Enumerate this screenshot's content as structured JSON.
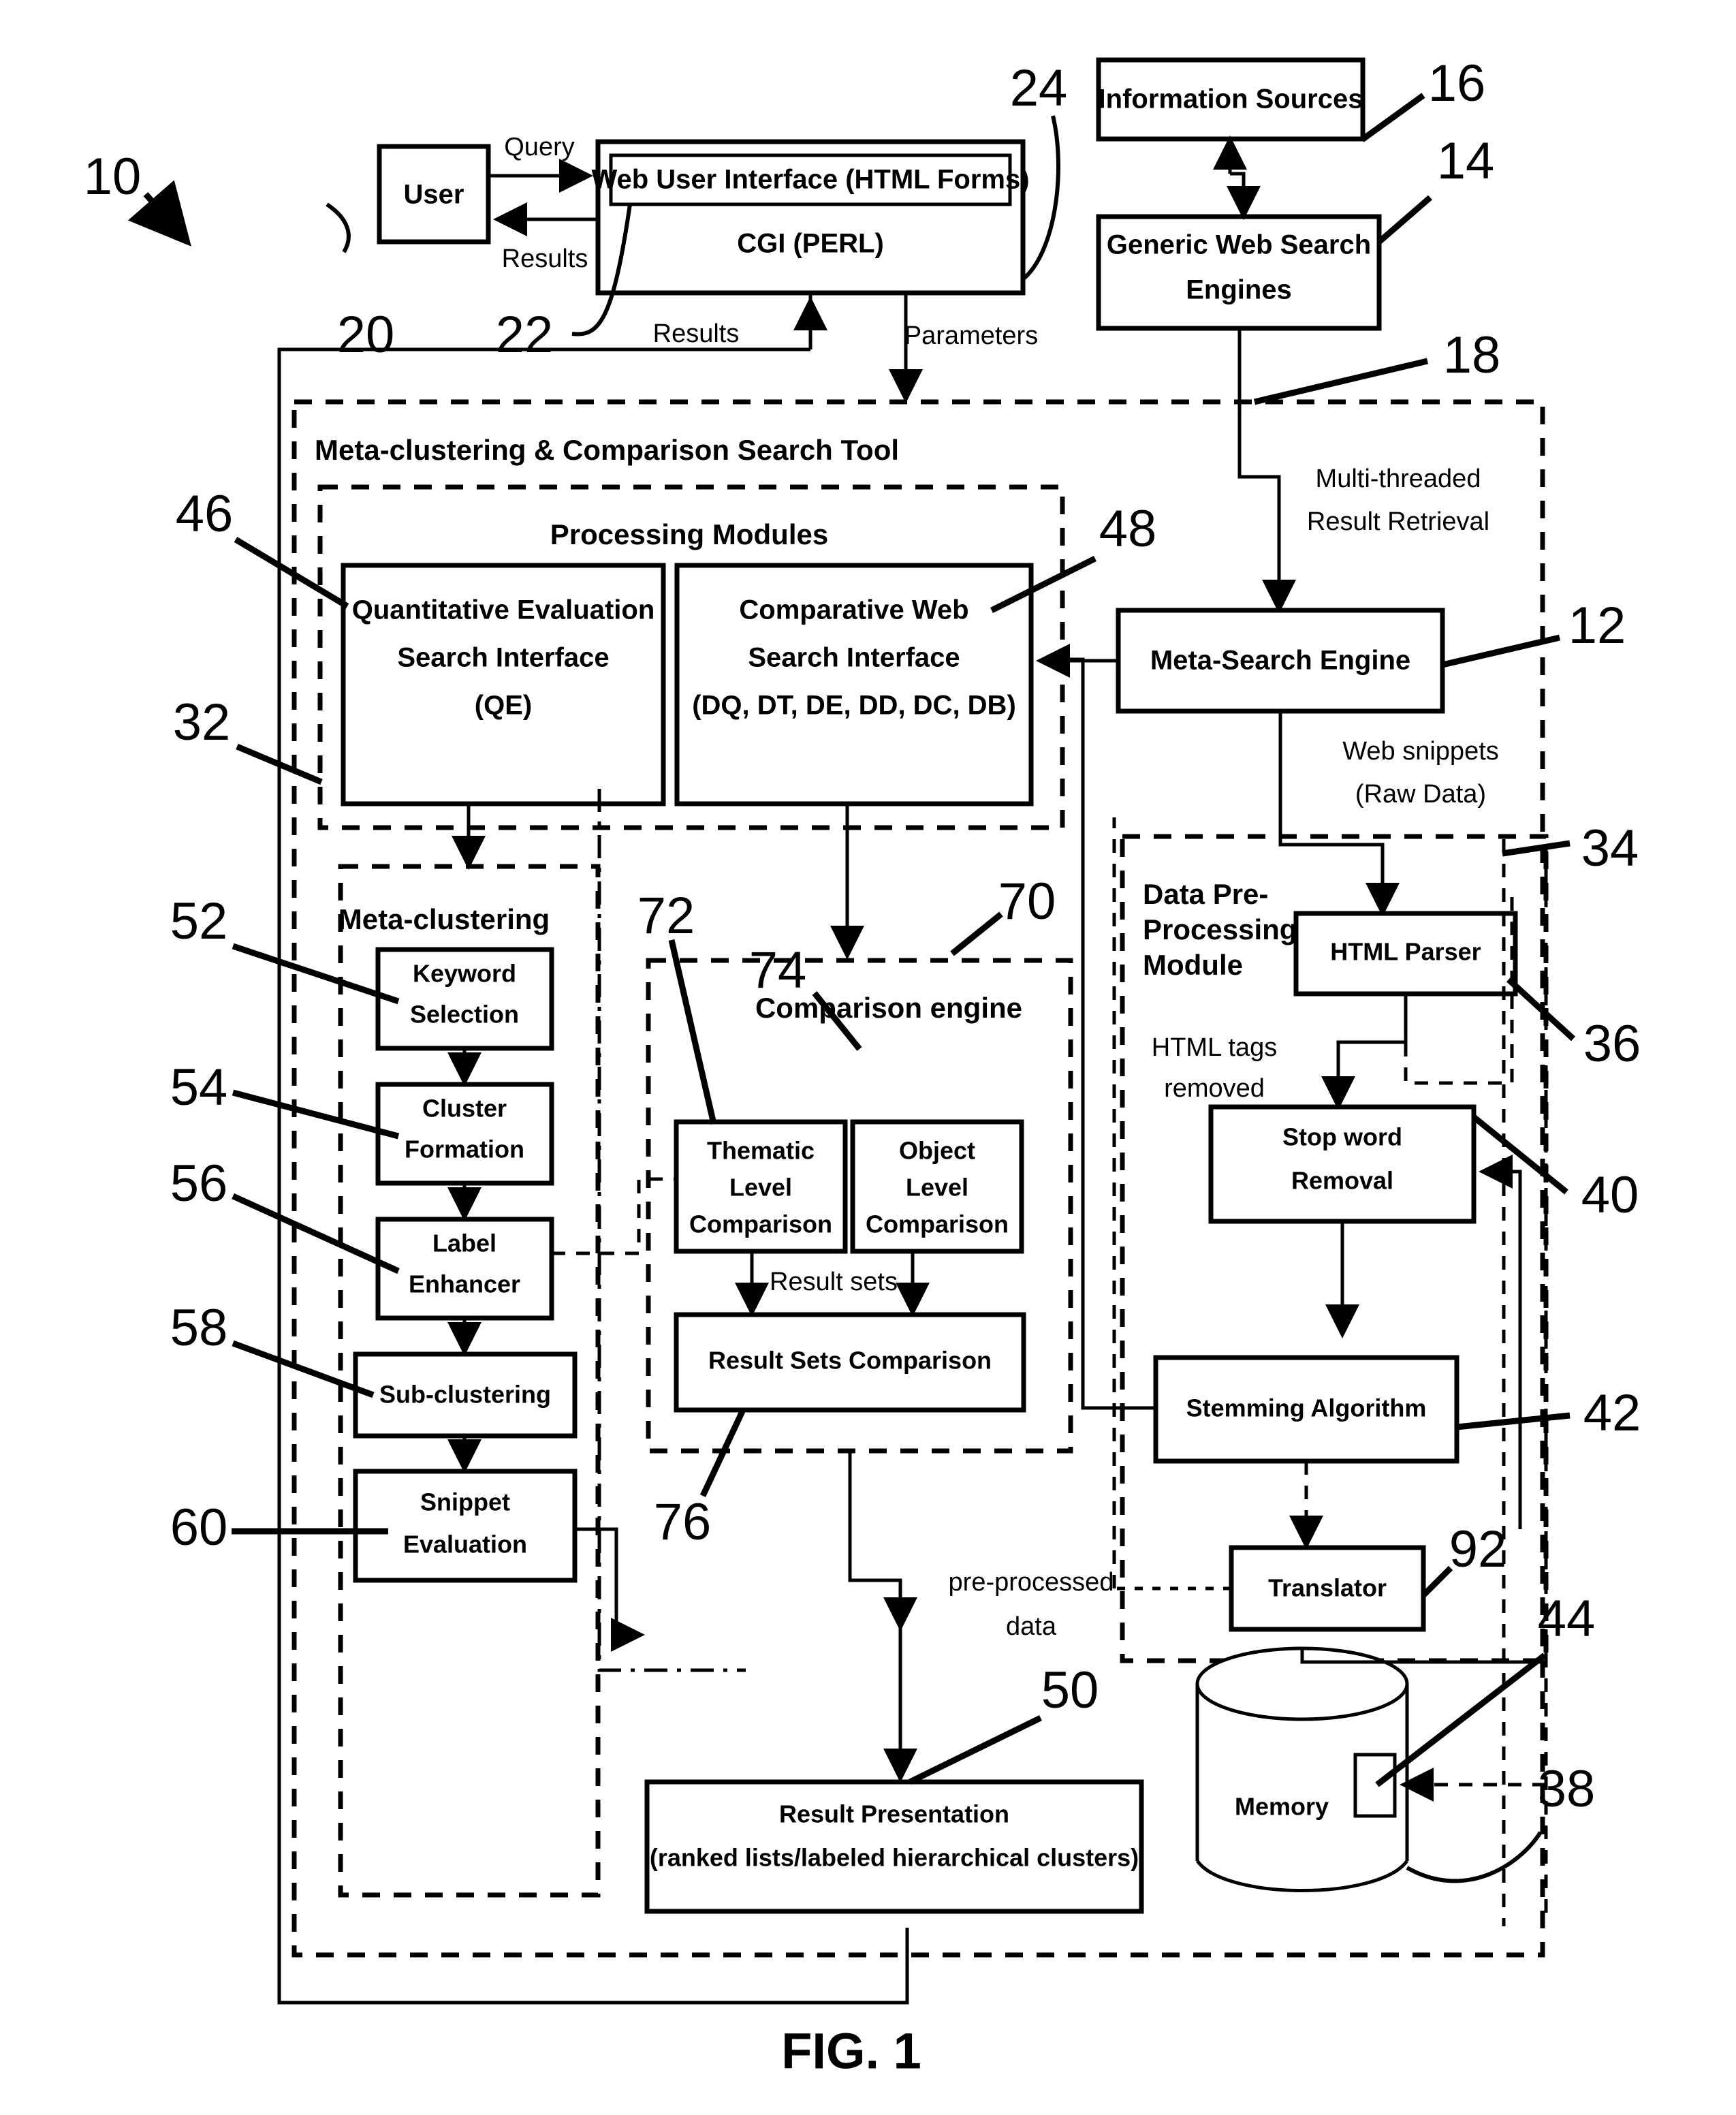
{
  "figure": {
    "caption": "FIG. 1",
    "system_ref": "10"
  },
  "boxes": {
    "user": {
      "label": "User",
      "ref": "20"
    },
    "web_ui": {
      "line1": "Web User Interface (HTML Forms)",
      "line2": "CGI (PERL)",
      "ref_inner": "22",
      "ref_outer": "24"
    },
    "information_sources": {
      "label": "Information Sources",
      "ref": "16"
    },
    "generic_web_search_engines": {
      "line1": "Generic Web Search",
      "line2": "Engines",
      "ref": "14"
    },
    "meta_search_engine": {
      "label": "Meta-Search Engine",
      "ref": "12"
    },
    "quantitative_evaluation": {
      "line1": "Quantitative Evaluation",
      "line2": "Search Interface",
      "line3": "(QE)",
      "ref": "46"
    },
    "comparative_web": {
      "line1": "Comparative Web",
      "line2": "Search Interface",
      "line3": "(DQ, DT, DE, DD, DC, DB)",
      "ref": "48"
    },
    "keyword_selection": {
      "line1": "Keyword",
      "line2": "Selection",
      "ref": "52"
    },
    "cluster_formation": {
      "line1": "Cluster",
      "line2": "Formation",
      "ref": "54"
    },
    "label_enhancer": {
      "line1": "Label",
      "line2": "Enhancer",
      "ref": "56"
    },
    "sub_clustering": {
      "label": "Sub-clustering",
      "ref": "58"
    },
    "snippet_evaluation": {
      "line1": "Snippet",
      "line2": "Evaluation",
      "ref": "60"
    },
    "thematic_level_comparison": {
      "line1": "Thematic",
      "line2": "Level",
      "line3": "Comparison",
      "ref": "72"
    },
    "object_level_comparison": {
      "line1": "Object",
      "line2": "Level",
      "line3": "Comparison",
      "ref": "74"
    },
    "result_sets_comparison": {
      "label": "Result Sets Comparison",
      "ref": "76"
    },
    "result_presentation": {
      "line1": "Result Presentation",
      "line2": "(ranked lists/labeled hierarchical clusters)",
      "ref": "50"
    },
    "html_parser": {
      "label": "HTML Parser",
      "ref": "36"
    },
    "stop_word_removal": {
      "line1": "Stop word",
      "line2": "Removal",
      "ref": "40"
    },
    "stemming_algorithm": {
      "label": "Stemming Algorithm",
      "ref": "42"
    },
    "translator": {
      "label": "Translator",
      "ref": "92"
    },
    "memory": {
      "label": "Memory",
      "ref_inner": "44",
      "ref_outer": "38"
    }
  },
  "groups": {
    "meta_clustering_tool": {
      "title": "Meta-clustering & Comparison Search Tool",
      "ref": "18"
    },
    "processing_modules": {
      "title": "Processing Modules",
      "ref": "32"
    },
    "meta_clustering": {
      "title": "Meta-clustering"
    },
    "comparison_engine": {
      "title": "Comparison engine",
      "ref": "70"
    },
    "data_preprocessing": {
      "line1": "Data Pre-",
      "line2": "Processing",
      "line3": "Module",
      "ref": "34"
    }
  },
  "edges": {
    "query": "Query",
    "results_user": "Results",
    "results_up": "Results",
    "parameters": "Parameters",
    "multi_threaded": {
      "line1": "Multi-threaded",
      "line2": "Result Retrieval"
    },
    "web_snippets": {
      "line1": "Web snippets",
      "line2": "(Raw Data)"
    },
    "html_tags_removed": {
      "line1": "HTML tags",
      "line2": "removed"
    },
    "result_sets": "Result sets",
    "pre_processed_data": {
      "line1": "pre-processed",
      "line2": "data"
    }
  }
}
